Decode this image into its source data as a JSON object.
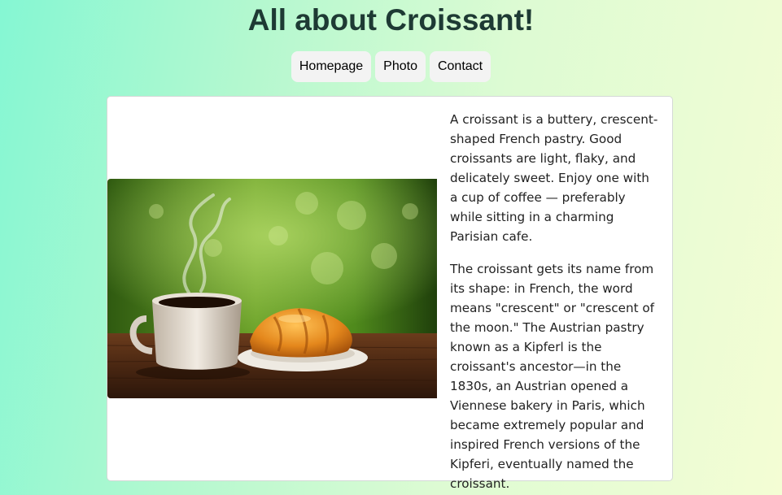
{
  "header": {
    "title": "All about Croissant!"
  },
  "nav": {
    "items": [
      {
        "label": "Homepage"
      },
      {
        "label": "Photo"
      },
      {
        "label": "Contact"
      }
    ]
  },
  "content": {
    "paragraphs": [
      "A croissant is a buttery, crescent-shaped French pastry. Good croissants are light, flaky, and delicately sweet. Enjoy one with a cup of coffee — preferably while sitting in a charming Parisian cafe.",
      "The croissant gets its name from its shape: in French, the word means \"crescent\" or \"crescent of the moon.\" The Austrian pastry known as a Kipferl is the croissant's ancestor—in the 1830s, an Austrian opened a Viennese bakery in Paris, which became extremely popular and inspired French versions of the Kipferi, eventually named the croissant."
    ]
  },
  "colors": {
    "background_left": "#85f7d3",
    "background_right": "#f4fdd4",
    "nav_button_bg": "#f3f3f3",
    "card_bg": "#ffffff"
  },
  "icons": {
    "photo": "coffee-and-croissant-photo"
  }
}
